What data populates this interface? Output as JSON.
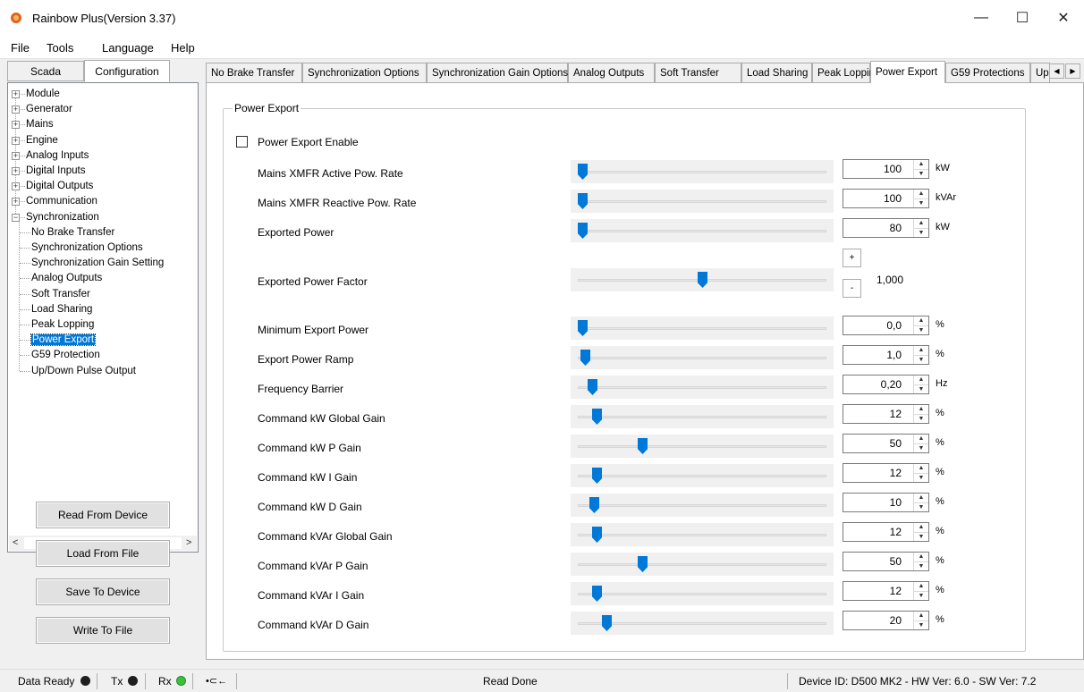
{
  "window": {
    "title": "Rainbow Plus(Version 3.37)",
    "minimize": "—",
    "maximize": "☐",
    "close": "✕"
  },
  "menu": [
    "File",
    "Tools",
    "Language",
    "Help"
  ],
  "left_tabs": [
    "Scada",
    "Configuration"
  ],
  "tree": {
    "root_items": [
      "Module",
      "Generator",
      "Mains",
      "Engine",
      "Analog Inputs",
      "Digital Inputs",
      "Digital Outputs",
      "Communication",
      "Synchronization"
    ],
    "expand_plus": "+",
    "expand_minus": "−",
    "sync_children": [
      "No Brake Transfer",
      "Synchronization Options",
      "Synchronization Gain Setting",
      "Analog Outputs",
      "Soft Transfer",
      "Load Sharing",
      "Peak Lopping",
      "Power Export",
      "G59 Protection",
      "Up/Down Pulse Output"
    ],
    "selected": "Power Export",
    "scroll_left": "<",
    "scroll_right": ">"
  },
  "actions": [
    "Read From Device",
    "Load From File",
    "Save To Device",
    "Write To File"
  ],
  "tabs": [
    "No Brake Transfer",
    "Synchronization Options",
    "Synchronization Gain Options",
    "Analog Outputs",
    "Soft Transfer",
    "Load Sharing",
    "Peak Lopping",
    "Power Export",
    "G59 Protections",
    "Up."
  ],
  "active_tab": "Power Export",
  "tab_scroll": {
    "left": "◀",
    "right": "▶"
  },
  "group": {
    "title": "Power Export",
    "checkbox_label": "Power Export Enable",
    "checkbox_checked": false,
    "settings": [
      {
        "label": "Mains XMFR Active Pow. Rate",
        "value": "100",
        "unit": "kW",
        "level": 0.0
      },
      {
        "label": "Mains XMFR Reactive Pow. Rate",
        "value": "100",
        "unit": "kVAr",
        "level": 0.0
      },
      {
        "label": "Exported Power",
        "value": "80",
        "unit": "kW",
        "level": 0.0
      },
      {
        "label": "Minimum Export Power",
        "value": "0,0",
        "unit": "%",
        "level": 0.0
      },
      {
        "label": "Export Power Ramp",
        "value": "1,0",
        "unit": "%",
        "level": 0.01
      },
      {
        "label": "Frequency Barrier",
        "value": "0,20",
        "unit": "Hz",
        "level": 0.04
      },
      {
        "label": "Command kW Global Gain",
        "value": "12",
        "unit": "%",
        "level": 0.06
      },
      {
        "label": "Command kW P Gain",
        "value": "50",
        "unit": "%",
        "level": 0.25
      },
      {
        "label": "Command kW I Gain",
        "value": "12",
        "unit": "%",
        "level": 0.06
      },
      {
        "label": "Command kW D Gain",
        "value": "10",
        "unit": "%",
        "level": 0.05
      },
      {
        "label": "Command kVAr Global Gain",
        "value": "12",
        "unit": "%",
        "level": 0.06
      },
      {
        "label": "Command kVAr P Gain",
        "value": "50",
        "unit": "%",
        "level": 0.25
      },
      {
        "label": "Command kVAr I Gain",
        "value": "12",
        "unit": "%",
        "level": 0.06
      },
      {
        "label": "Command kVAr D Gain",
        "value": "20",
        "unit": "%",
        "level": 0.1
      }
    ],
    "power_factor": {
      "label": "Exported Power Factor",
      "value": "1,000",
      "level": 0.5,
      "plus": "+",
      "minus": "-"
    },
    "spin_up": "▲",
    "spin_down": "▼"
  },
  "status": {
    "data_ready": "Data Ready",
    "tx": "Tx",
    "rx": "Rx",
    "usb_icon": "•⊂←",
    "message": "Read Done",
    "device": "Device ID: D500 MK2 - HW Ver: 6.0 - SW Ver: 7.2",
    "led_colors": {
      "data_ready": "#1e1e1e",
      "tx": "#1e1e1e",
      "rx": "#3cbf3c"
    }
  }
}
